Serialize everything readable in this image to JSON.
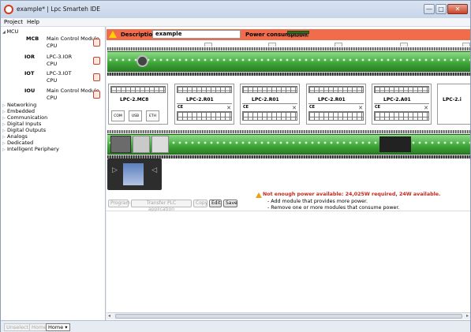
{
  "window": {
    "title": "example* | Lpc Smarteh IDE",
    "min_label": "—",
    "max_label": "□",
    "close_label": "✕"
  },
  "menu": {
    "items": [
      "Project",
      "Help"
    ]
  },
  "sidebar": {
    "root": "MCU",
    "modules": [
      {
        "code": "MCB",
        "name": "Main Control Module",
        "cpu": "CPU"
      },
      {
        "code": "IOR",
        "name": "LPC-3.IOR",
        "cpu": "CPU"
      },
      {
        "code": "IOT",
        "name": "LPC-3.IOT",
        "cpu": "CPU"
      },
      {
        "code": "IOU",
        "name": "Main Control Module",
        "cpu": "CPU"
      }
    ],
    "categories": [
      "Networking",
      "Embedded",
      "Communication",
      "Digital Inputs",
      "Digital Outputs",
      "Analogs",
      "Dedicated",
      "Intelligent Periphery"
    ]
  },
  "descbar": {
    "description_label": "Description",
    "description_value": "example",
    "power_label": "Power consumption",
    "power_value": "24,02/24W"
  },
  "modules_labels": [
    {
      "name": "LPC-2.MC8"
    },
    {
      "name": "LPC-2.R01"
    },
    {
      "name": "LPC-2.R01"
    },
    {
      "name": "LPC-2.R01"
    },
    {
      "name": "LPC-2.A01"
    },
    {
      "name": "LPC-2.i"
    }
  ],
  "mcb_ports": [
    "COM",
    "USB",
    "ETH"
  ],
  "buttons": {
    "program": "Program",
    "transfer": "Transfer PLC application",
    "copy": "Copy",
    "edit": "Edit",
    "save": "Save"
  },
  "alert": {
    "heading": "Not enough power available: 24,025W required, 24W available.",
    "line1": "- Add module that provides more power.",
    "line2": "- Remove one or more modules that consume power."
  },
  "statusbar": {
    "unselect": "Unselect",
    "home": "Home",
    "home_dropdown": "Home ▾"
  },
  "colors": {
    "accent": "#f06c4a",
    "module_green": "#3da437",
    "alert_red": "#c6281d"
  }
}
